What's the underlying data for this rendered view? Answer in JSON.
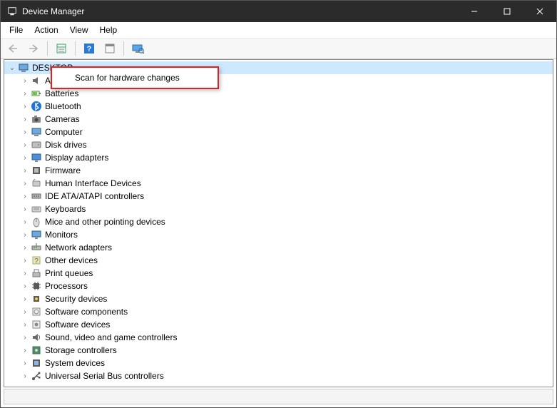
{
  "title": "Device Manager",
  "menubar": {
    "items": [
      {
        "label": "File"
      },
      {
        "label": "Action"
      },
      {
        "label": "View"
      },
      {
        "label": "Help"
      }
    ]
  },
  "toolbar": {
    "back_tip": "Back",
    "forward_tip": "Forward",
    "props_tip": "Properties",
    "help_tip": "Help",
    "showhide_tip": "Show hidden devices",
    "scan_tip": "Scan for hardware changes"
  },
  "tree": {
    "root": {
      "label": "DESKTOP",
      "expanded": true,
      "selected": true
    },
    "children": [
      {
        "icon": "audio",
        "label": "A"
      },
      {
        "icon": "battery",
        "label": "Batteries"
      },
      {
        "icon": "bluetooth",
        "label": "Bluetooth"
      },
      {
        "icon": "camera",
        "label": "Cameras"
      },
      {
        "icon": "computer",
        "label": "Computer"
      },
      {
        "icon": "disk",
        "label": "Disk drives"
      },
      {
        "icon": "display",
        "label": "Display adapters"
      },
      {
        "icon": "firmware",
        "label": "Firmware"
      },
      {
        "icon": "hid",
        "label": "Human Interface Devices"
      },
      {
        "icon": "ide",
        "label": "IDE ATA/ATAPI controllers"
      },
      {
        "icon": "keyboard",
        "label": "Keyboards"
      },
      {
        "icon": "mouse",
        "label": "Mice and other pointing devices"
      },
      {
        "icon": "monitor",
        "label": "Monitors"
      },
      {
        "icon": "network",
        "label": "Network adapters"
      },
      {
        "icon": "other",
        "label": "Other devices"
      },
      {
        "icon": "printqueue",
        "label": "Print queues"
      },
      {
        "icon": "processor",
        "label": "Processors"
      },
      {
        "icon": "security",
        "label": "Security devices"
      },
      {
        "icon": "softcomp",
        "label": "Software components"
      },
      {
        "icon": "softdev",
        "label": "Software devices"
      },
      {
        "icon": "sound",
        "label": "Sound, video and game controllers"
      },
      {
        "icon": "storage",
        "label": "Storage controllers"
      },
      {
        "icon": "system",
        "label": "System devices"
      },
      {
        "icon": "usb",
        "label": "Universal Serial Bus controllers"
      }
    ]
  },
  "context_menu": {
    "items": [
      {
        "label": "Scan for hardware changes"
      }
    ]
  }
}
